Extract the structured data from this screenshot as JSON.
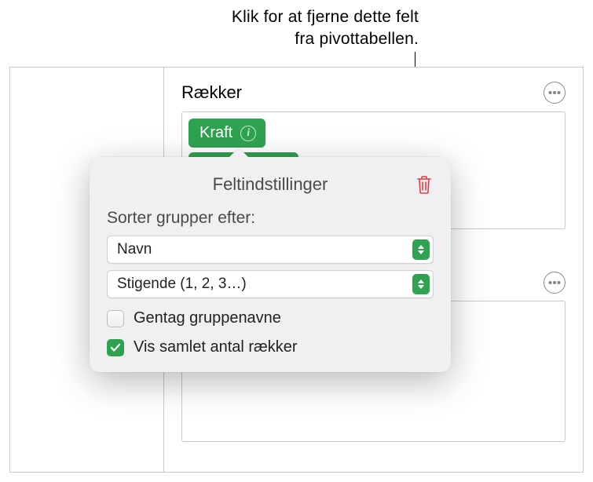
{
  "callout": {
    "line1": "Klik for at fjerne dette felt",
    "line2": "fra pivottabellen."
  },
  "sidebar": {
    "section_title": "Rækker",
    "field_chip_label": "Kraft"
  },
  "popover": {
    "title": "Feltindstillinger",
    "sort_label": "Sorter grupper efter:",
    "sort_by_value": "Navn",
    "sort_order_value": "Stigende (1, 2, 3…)",
    "repeat_names_label": "Gentag gruppenavne",
    "repeat_names_checked": false,
    "show_totals_label": "Vis samlet antal rækker",
    "show_totals_checked": true
  },
  "icons": {
    "info": "i"
  }
}
